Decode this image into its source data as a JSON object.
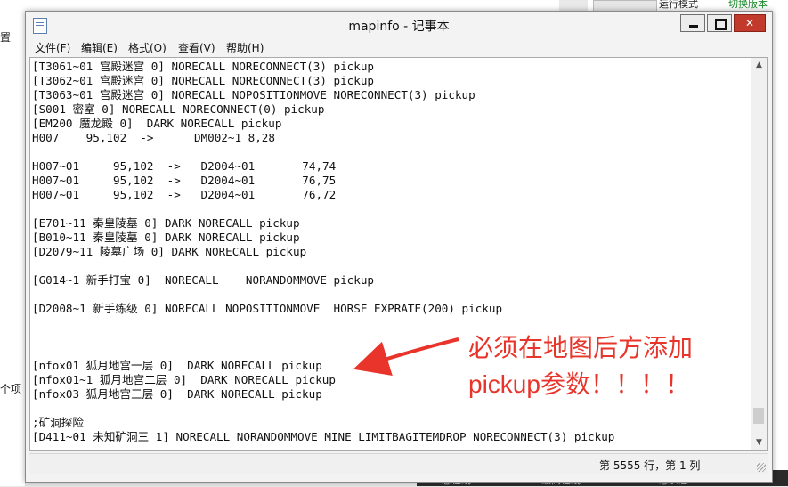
{
  "background": {
    "left_fragments": [
      "置",
      "个项"
    ],
    "right_header": [
      "运行模式",
      "切换版本"
    ],
    "taskbar_fragments": [
      "总在线: 0",
      "最高在线: 1",
      "总状态: 0"
    ]
  },
  "window": {
    "title": "mapinfo - 记事本",
    "buttons": {
      "minimize": "",
      "maximize": "",
      "close": "✕"
    }
  },
  "menu": [
    {
      "label": "文件(F)"
    },
    {
      "label": "编辑(E)"
    },
    {
      "label": "格式(O)"
    },
    {
      "label": "查看(V)"
    },
    {
      "label": "帮助(H)"
    }
  ],
  "editor": {
    "lines": [
      "[T3061~01 宫殿迷宫 0] NORECALL NORECONNECT(3) pickup",
      "[T3062~01 宫殿迷宫 0] NORECALL NORECONNECT(3) pickup",
      "[T3063~01 宫殿迷宫 0] NORECALL NOPOSITIONMOVE NORECONNECT(3) pickup",
      "[S001 密室 0] NORECALL NORECONNECT(0) pickup",
      "[EM200 魔龙殿 0]  DARK NORECALL pickup",
      "H007    95,102  ->      DM002~1 8,28",
      "",
      "H007~01     95,102  ->   D2004~01       74,74",
      "H007~01     95,102  ->   D2004~01       76,75",
      "H007~01     95,102  ->   D2004~01       76,72",
      "",
      "[E701~11 秦皇陵墓 0] DARK NORECALL pickup",
      "[B010~11 秦皇陵墓 0] DARK NORECALL pickup",
      "[D2079~11 陵墓广场 0] DARK NORECALL pickup",
      "",
      "[G014~1 新手打宝 0]  NORECALL    NORANDOMMOVE pickup",
      "",
      "[D2008~1 新手练级 0] NORECALL NOPOSITIONMOVE  HORSE EXPRATE(200) pickup",
      "",
      "",
      "",
      "[nfox01 狐月地宫一层 0]  DARK NORECALL pickup",
      "[nfox01~1 狐月地宫二层 0]  DARK NORECALL pickup",
      "[nfox03 狐月地宫三层 0]  DARK NORECALL pickup",
      "",
      ";矿洞探险",
      "[D411~01 未知矿洞三 1] NORECALL NORANDOMMOVE MINE LIMITBAGITEMDROP NORECONNECT(3) pickup"
    ]
  },
  "status": {
    "position": "第 5555 行，第 1 列"
  },
  "annotation": {
    "line1": "必须在地图后方添加",
    "line2": "pickup参数！！！！",
    "color": "#e8342a"
  }
}
